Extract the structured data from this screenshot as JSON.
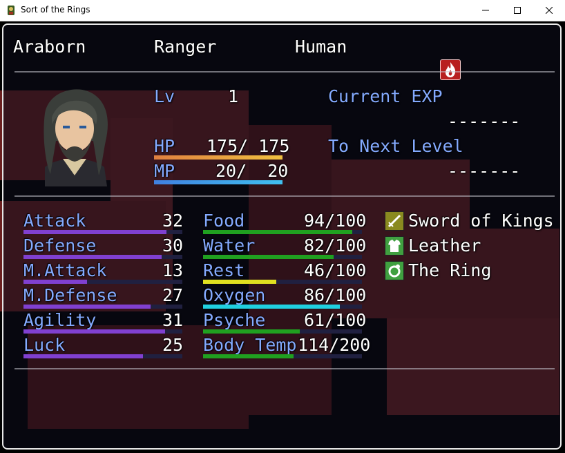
{
  "window": {
    "title": "Sort of the Rings"
  },
  "actor": {
    "name": "Araborn",
    "class": "Ranger",
    "race": "Human",
    "state_icon": "fire-icon"
  },
  "level": {
    "label": "Lv",
    "value": "1"
  },
  "hp": {
    "label": "HP",
    "value": "175/ 175",
    "fraction": 1.0,
    "color_a": "#e08040",
    "color_b": "#f0c040"
  },
  "mp": {
    "label": "MP",
    "value": "20/  20",
    "fraction": 1.0,
    "color_a": "#4080e0",
    "color_b": "#40c0f0"
  },
  "exp": {
    "current_label": "Current EXP",
    "current_value": "-------",
    "next_label": "To Next Level",
    "next_value": "-------"
  },
  "params": [
    {
      "label": "Attack",
      "value": "32",
      "fraction": 0.9
    },
    {
      "label": "Defense",
      "value": "30",
      "fraction": 0.87
    },
    {
      "label": "M.Attack",
      "value": "13",
      "fraction": 0.4
    },
    {
      "label": "M.Defense",
      "value": "27",
      "fraction": 0.8
    },
    {
      "label": "Agility",
      "value": "31",
      "fraction": 0.89
    },
    {
      "label": "Luck",
      "value": "25",
      "fraction": 0.75
    }
  ],
  "param_color": "#8040d0",
  "needs": [
    {
      "label": "Food",
      "value": "94/100",
      "fraction": 0.94,
      "color": "#20a020"
    },
    {
      "label": "Water",
      "value": "82/100",
      "fraction": 0.82,
      "color": "#20a020"
    },
    {
      "label": "Rest",
      "value": "46/100",
      "fraction": 0.46,
      "color": "#e0e020"
    },
    {
      "label": "Oxygen",
      "value": "86/100",
      "fraction": 0.86,
      "color": "#20d0e0"
    },
    {
      "label": "Psyche",
      "value": "61/100",
      "fraction": 0.61,
      "color": "#20a020"
    },
    {
      "label": "Body Temp",
      "value": "114/200",
      "fraction": 0.57,
      "color": "#20a020"
    }
  ],
  "equipment": [
    {
      "name": "Sword of Kings",
      "icon": "sword-icon",
      "icon_color": "#8a8a20"
    },
    {
      "name": "Leather",
      "icon": "armor-icon",
      "icon_color": "#40a040"
    },
    {
      "name": "The Ring",
      "icon": "ring-icon",
      "icon_color": "#40a040"
    }
  ]
}
